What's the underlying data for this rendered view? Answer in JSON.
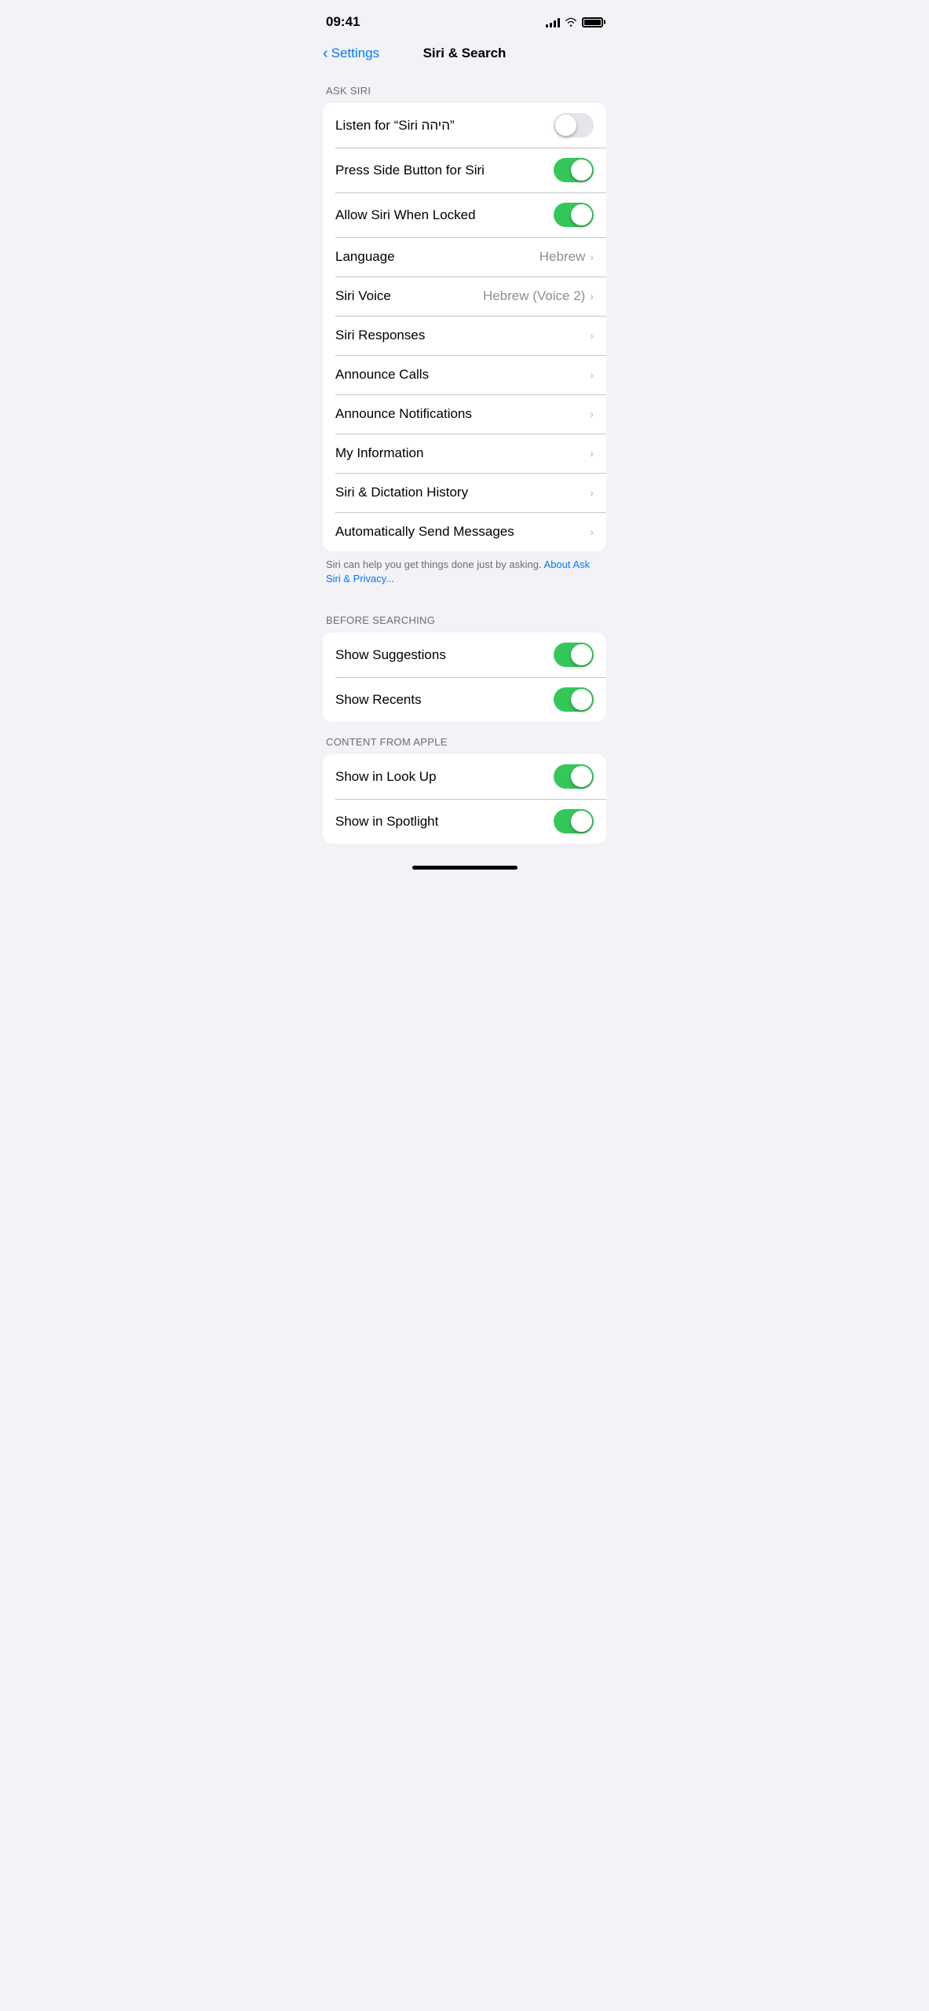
{
  "statusBar": {
    "time": "09:41",
    "batteryFull": true
  },
  "header": {
    "backLabel": "Settings",
    "title": "Siri & Search"
  },
  "sections": [
    {
      "id": "ask-siri",
      "header": "ASK SIRI",
      "rows": [
        {
          "id": "listen-for-siri",
          "label": "Listen for “Siri היהה”",
          "type": "toggle",
          "toggleOn": false
        },
        {
          "id": "press-side-button",
          "label": "Press Side Button for Siri",
          "type": "toggle",
          "toggleOn": true
        },
        {
          "id": "allow-when-locked",
          "label": "Allow Siri When Locked",
          "type": "toggle",
          "toggleOn": true
        },
        {
          "id": "language",
          "label": "Language",
          "type": "value-chevron",
          "value": "Hebrew"
        },
        {
          "id": "siri-voice",
          "label": "Siri Voice",
          "type": "value-chevron",
          "value": "Hebrew (Voice 2)"
        },
        {
          "id": "siri-responses",
          "label": "Siri Responses",
          "type": "chevron",
          "value": ""
        },
        {
          "id": "announce-calls",
          "label": "Announce Calls",
          "type": "chevron",
          "value": ""
        },
        {
          "id": "announce-notifications",
          "label": "Announce Notifications",
          "type": "chevron",
          "value": ""
        },
        {
          "id": "my-information",
          "label": "My Information",
          "type": "chevron",
          "value": ""
        },
        {
          "id": "siri-dictation-history",
          "label": "Siri & Dictation History",
          "type": "chevron",
          "value": ""
        },
        {
          "id": "auto-send-messages",
          "label": "Automatically Send Messages",
          "type": "chevron",
          "value": ""
        }
      ],
      "footer": "Siri can help you get things done just by asking.",
      "footerLink": "About Ask Siri & Privacy..."
    },
    {
      "id": "before-searching",
      "header": "BEFORE SEARCHING",
      "rows": [
        {
          "id": "show-suggestions",
          "label": "Show Suggestions",
          "type": "toggle",
          "toggleOn": true
        },
        {
          "id": "show-recents",
          "label": "Show Recents",
          "type": "toggle",
          "toggleOn": true
        }
      ],
      "footer": "",
      "footerLink": ""
    },
    {
      "id": "content-from-apple",
      "header": "CONTENT FROM APPLE",
      "rows": [
        {
          "id": "show-in-look-up",
          "label": "Show in Look Up",
          "type": "toggle",
          "toggleOn": true
        },
        {
          "id": "show-in-spotlight",
          "label": "Show in Spotlight",
          "type": "toggle",
          "toggleOn": true
        }
      ],
      "footer": "",
      "footerLink": ""
    }
  ]
}
